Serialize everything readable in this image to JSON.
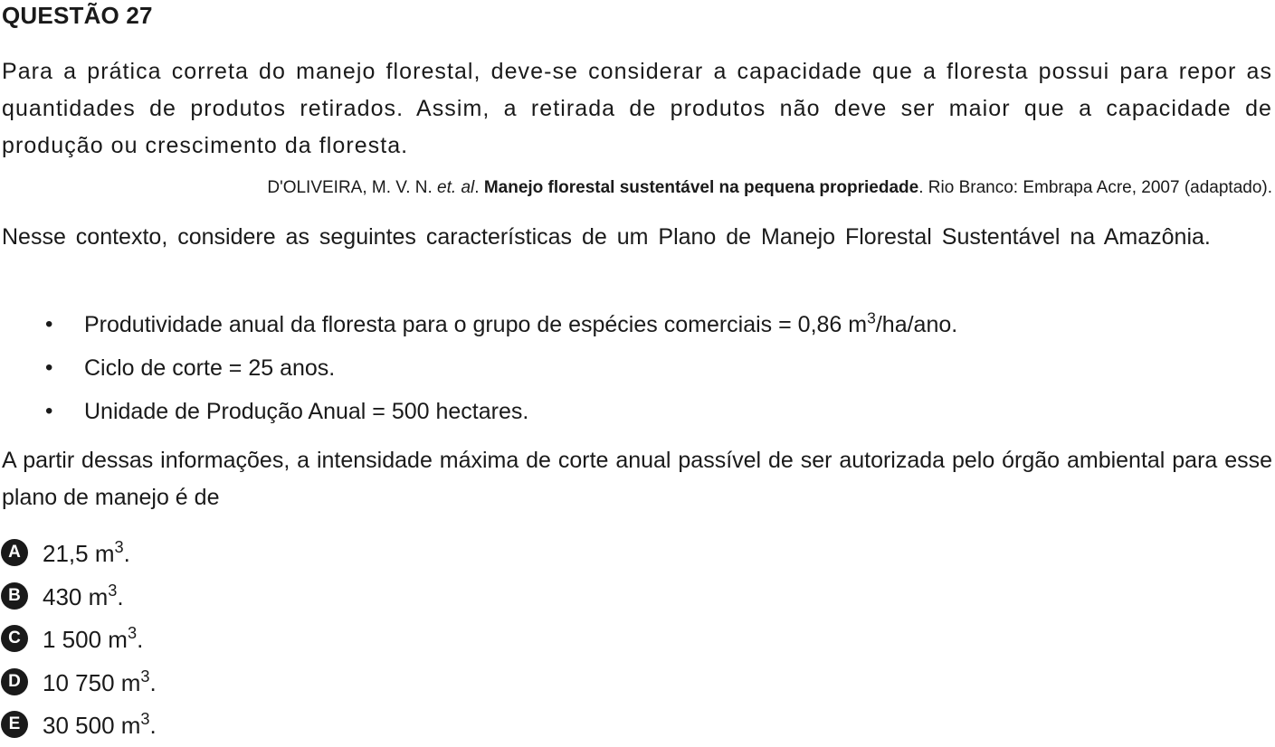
{
  "header": {
    "title": "QUESTÃO 27"
  },
  "intro": {
    "text": "Para a prática correta do manejo florestal, deve-se considerar a capacidade que a floresta possui para repor as quantidades de produtos retirados. Assim, a retirada de produtos não deve ser maior que a capacidade de produção ou crescimento da floresta."
  },
  "citation": {
    "authors": "D'OLIVEIRA, M. V. N. ",
    "etal": "et. al",
    "sep1": ". ",
    "work_title": "Manejo florestal sustentável na pequena propriedade",
    "rest": ". Rio Branco: Embrapa Acre, 2007 (adaptado)."
  },
  "context": {
    "text": "Nesse contexto, considere as seguintes características de um Plano de Manejo Florestal Sustentável na Amazônia."
  },
  "bullets": [
    {
      "marker": "•",
      "text": "Produtividade anual da floresta para o grupo de espécies comerciais = 0,86 m",
      "sup": "3",
      "suffix": "/ha/ano."
    },
    {
      "marker": "•",
      "text": "Ciclo de corte = 25 anos.",
      "sup": "",
      "suffix": ""
    },
    {
      "marker": "•",
      "text": "Unidade de Produção Anual = 500 hectares.",
      "sup": "",
      "suffix": ""
    }
  ],
  "question": {
    "text": "A partir dessas informações, a intensidade máxima de corte anual passível de ser autorizada pelo órgão ambiental para esse plano de manejo é de"
  },
  "options": [
    {
      "letter": "A",
      "value": "21,5 m",
      "sup": "3",
      "suffix": "."
    },
    {
      "letter": "B",
      "value": "430 m",
      "sup": "3",
      "suffix": "."
    },
    {
      "letter": "C",
      "value": "1 500 m",
      "sup": "3",
      "suffix": "."
    },
    {
      "letter": "D",
      "value": "10 750 m",
      "sup": "3",
      "suffix": "."
    },
    {
      "letter": "E",
      "value": "30 500 m",
      "sup": "3",
      "suffix": "."
    }
  ]
}
